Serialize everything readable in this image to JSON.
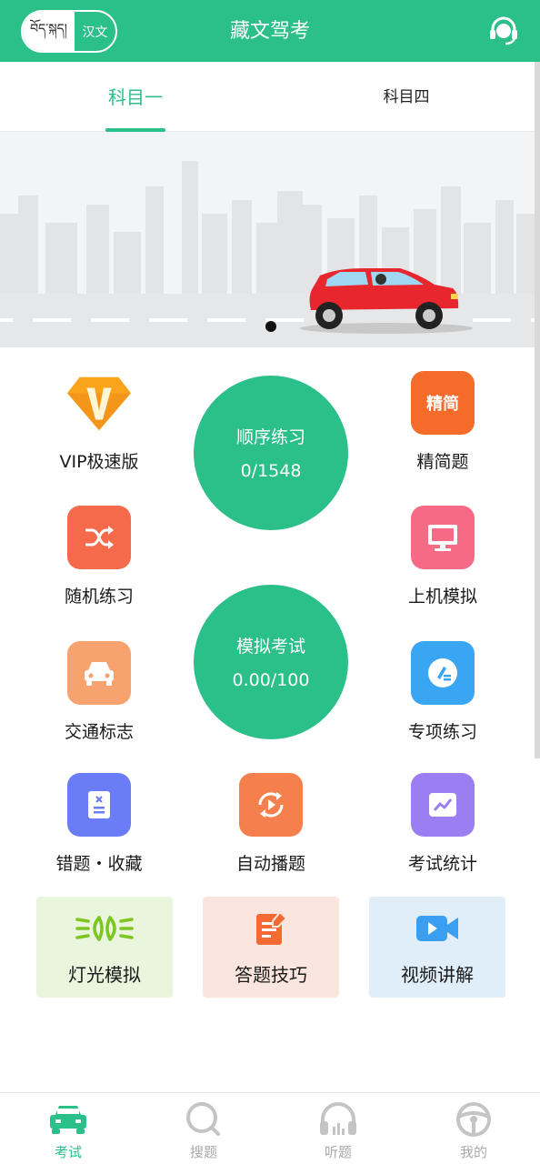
{
  "header": {
    "lang_tibetan": "བོད་སྐད།",
    "lang_chinese": "汉文",
    "title": "藏文驾考",
    "service_icon": "customer-service-icon"
  },
  "tabs": [
    {
      "label": "科目一",
      "active": true
    },
    {
      "label": "科目四",
      "active": false
    }
  ],
  "banner": {
    "icon": "car-city-illustration"
  },
  "grid": {
    "vip": {
      "label": "VIP极速版",
      "icon": "vip-diamond-icon",
      "color": "#f7a21b"
    },
    "simplified": {
      "label": "精简题",
      "icon_text": "精简",
      "color": "#f56b2a"
    },
    "random": {
      "label": "随机练习",
      "icon": "shuffle-icon",
      "color": "#f46a4a"
    },
    "computer_sim": {
      "label": "上机模拟",
      "icon": "monitor-icon",
      "color": "#f76a86"
    },
    "traffic_signs": {
      "label": "交通标志",
      "icon": "car-front-icon",
      "color": "#f7a36f"
    },
    "special": {
      "label": "专项练习",
      "icon": "pen-icon",
      "color": "#3aa5f2"
    },
    "mistakes": {
      "label": "错题・收藏",
      "icon": "document-icon",
      "color": "#6b7cf7"
    },
    "autoplay": {
      "label": "自动播题",
      "icon": "autoplay-icon",
      "color": "#f6804d"
    },
    "stats": {
      "label": "考试统计",
      "icon": "chart-icon",
      "color": "#9a7ef2"
    }
  },
  "sequential": {
    "title": "顺序练习",
    "value": "0/1548"
  },
  "mock_exam": {
    "title": "模拟考试",
    "value": "0.00/100"
  },
  "cards": [
    {
      "label": "灯光模拟",
      "icon": "headlight-icon",
      "bg": "#e9f5dc"
    },
    {
      "label": "答题技巧",
      "icon": "notepad-icon",
      "bg": "#fbe6df"
    },
    {
      "label": "视频讲解",
      "icon": "video-camera-icon",
      "bg": "#dfeef8"
    }
  ],
  "bottom_nav": [
    {
      "label": "考试",
      "icon": "car-icon",
      "active": true
    },
    {
      "label": "搜题",
      "icon": "search-icon",
      "active": false
    },
    {
      "label": "听题",
      "icon": "headphones-icon",
      "active": false
    },
    {
      "label": "我的",
      "icon": "steering-wheel-icon",
      "active": false
    }
  ],
  "colors": {
    "primary": "#2bbf8a",
    "inactive": "#aaaaaa"
  }
}
